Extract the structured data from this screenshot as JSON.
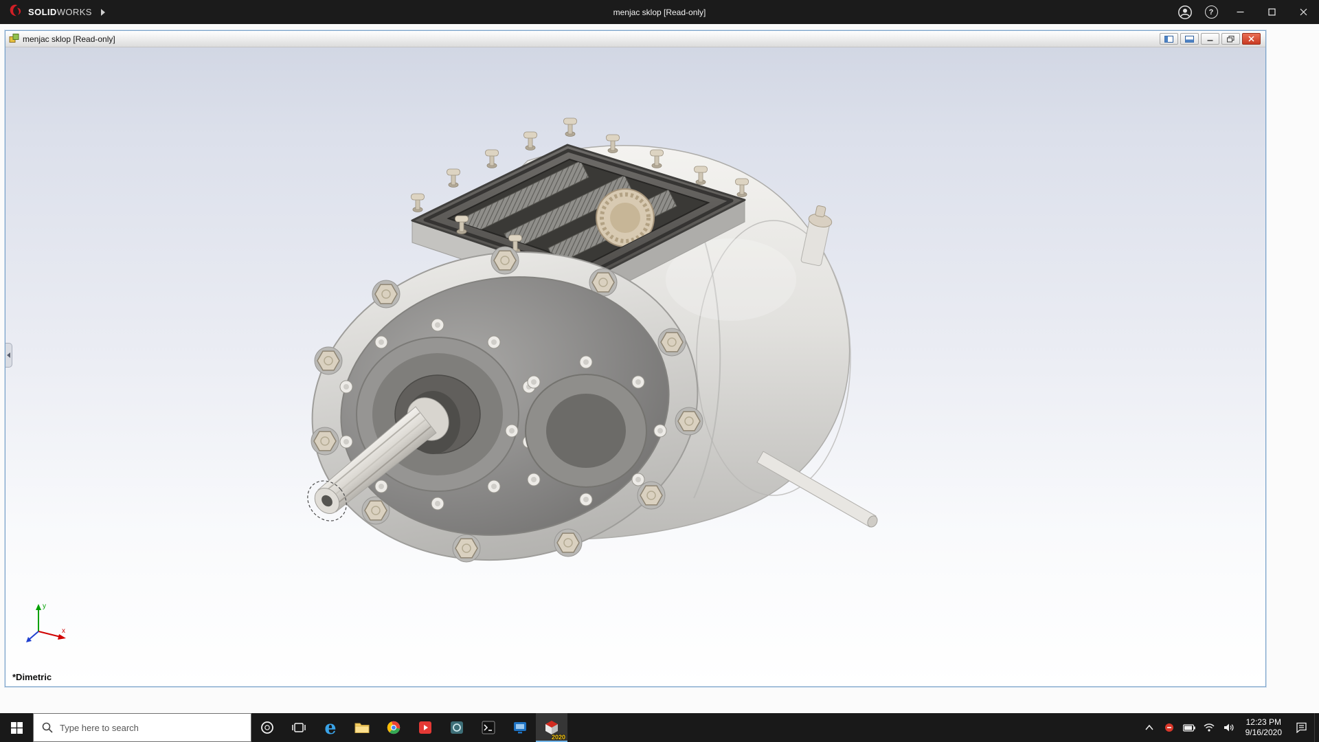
{
  "titlebar": {
    "brand_solid": "SOLID",
    "brand_works": "WORKS",
    "window_title": "menjac sklop [Read-only]",
    "help_glyph": "?"
  },
  "document": {
    "title": "menjac sklop [Read-only]",
    "view_label": "*Dimetric",
    "triad": {
      "x": "x",
      "y": "y"
    }
  },
  "taskbar": {
    "search_placeholder": "Type here to search",
    "edge_glyph": "e",
    "solidworks_badge": "2020",
    "clock_time": "12:23 PM",
    "clock_date": "9/16/2020"
  },
  "icons": {
    "brand_logo": "red-swoosh",
    "user": "person-circle",
    "help": "question-circle",
    "minimize": "dash",
    "maximize": "square",
    "close": "x",
    "doc_pane_left": "window-left-pane",
    "doc_pane_bottom": "window-bottom-pane",
    "start": "windows-grid",
    "search": "magnifier",
    "cortana": "circle",
    "task_view": "stacked-windows",
    "edge": "e",
    "file_explorer": "folder",
    "chrome": "chrome-wheel",
    "media_app": "red-tile",
    "teal_app": "teal-tile",
    "command_prompt": "terminal",
    "blue_app": "monitor",
    "solidworks_app": "sw-cube",
    "tray_chevron": "^",
    "tray_status": "red-dot",
    "battery": "battery",
    "network": "wifi",
    "volume": "speaker",
    "action_center": "comment-box"
  },
  "colors": {
    "accent_blue": "#76b9ed",
    "close_red": "#c93a22",
    "brand_red": "#d11f26",
    "titlebar_bg": "#1b1b1b",
    "taskbar_bg": "#191919",
    "viewport_top": "#d2d7e4",
    "sw_badge_yellow": "#f6c40a"
  }
}
